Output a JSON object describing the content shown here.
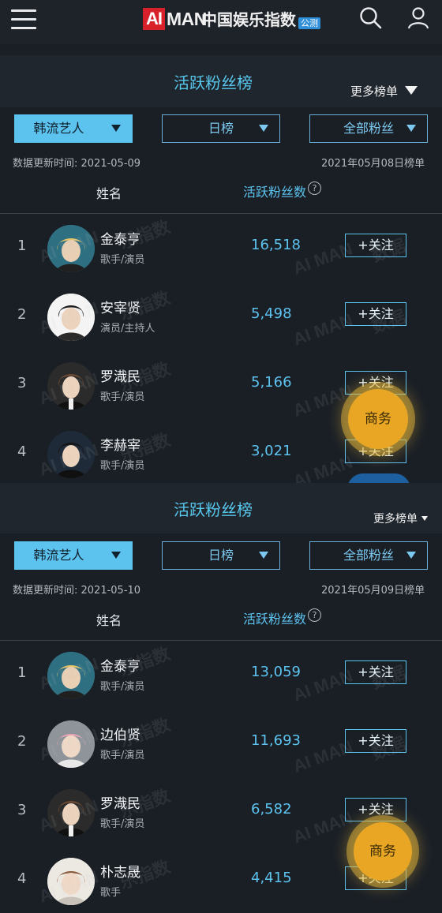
{
  "header": {
    "logo_ai": "AI",
    "logo_man": "MAN",
    "logo_cn": "中国娱乐指数",
    "logo_badge": "公测",
    "menu_icon": "hamburger-menu-icon",
    "search_icon": "search-icon",
    "user_icon": "user-icon"
  },
  "boards": [
    {
      "title": "活跃粉丝榜",
      "more_label": "更多榜单",
      "filters": {
        "category": "韩流艺人",
        "period": "日榜",
        "fans": "全部粉丝"
      },
      "update_time": "数据更新时间: 2021-05-09",
      "board_date": "2021年05月08日榜单",
      "col_name": "姓名",
      "col_fans": "活跃粉丝数",
      "rows": [
        {
          "rank": "1",
          "name": "金泰亨",
          "role": "歌手/演员",
          "count": "16,518",
          "follow": "+关注"
        },
        {
          "rank": "2",
          "name": "安宰贤",
          "role": "演员/主持人",
          "count": "5,498",
          "follow": "+关注"
        },
        {
          "rank": "3",
          "name": "罗渽民",
          "role": "歌手/演员",
          "count": "5,166",
          "follow": "+关注"
        },
        {
          "rank": "4",
          "name": "李赫宰",
          "role": "歌手/演员",
          "count": "3,021",
          "follow": "+关注"
        }
      ],
      "business_button": "商务"
    },
    {
      "title": "活跃粉丝榜",
      "more_label": "更多榜单",
      "filters": {
        "category": "韩流艺人",
        "period": "日榜",
        "fans": "全部粉丝"
      },
      "update_time": "数据更新时间: 2021-05-10",
      "board_date": "2021年05月09日榜单",
      "col_name": "姓名",
      "col_fans": "活跃粉丝数",
      "rows": [
        {
          "rank": "1",
          "name": "金泰亨",
          "role": "歌手/演员",
          "count": "13,059",
          "follow": "+关注"
        },
        {
          "rank": "2",
          "name": "边伯贤",
          "role": "歌手/演员",
          "count": "11,693",
          "follow": "+关注"
        },
        {
          "rank": "3",
          "name": "罗渽民",
          "role": "歌手/演员",
          "count": "6,582",
          "follow": "+关注"
        },
        {
          "rank": "4",
          "name": "朴志晟",
          "role": "歌手",
          "count": "4,415",
          "follow": "+关注"
        }
      ],
      "business_button": "商务"
    }
  ],
  "watermark_a": "AI MAN",
  "watermark_b": "乐指数",
  "watermark_c": "数据",
  "colors": {
    "accent": "#5cc2ee",
    "background": "#1a1f26",
    "business": "#e8a624"
  }
}
